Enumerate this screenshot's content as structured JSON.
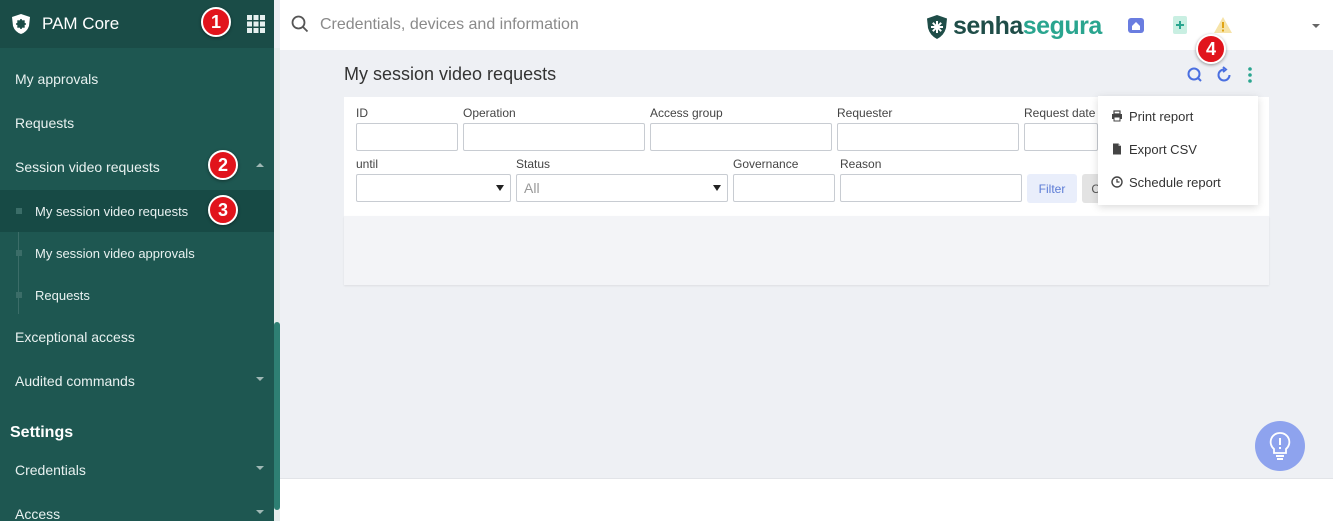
{
  "app": {
    "brand_name": "PAM Core",
    "logo_text_main": "senha",
    "logo_text_accent": "segura"
  },
  "search": {
    "placeholder": "Credentials, devices and information"
  },
  "sidebar": {
    "items": [
      {
        "label": "My approvals"
      },
      {
        "label": "Requests"
      },
      {
        "label": "Session video requests"
      },
      {
        "label": "Exceptional access"
      },
      {
        "label": "Audited commands"
      }
    ],
    "subitems": [
      {
        "label": "My session video requests"
      },
      {
        "label": "My session video approvals"
      },
      {
        "label": "Requests"
      }
    ],
    "settings_heading": "Settings",
    "settings_items": [
      {
        "label": "Credentials"
      },
      {
        "label": "Access"
      }
    ]
  },
  "page": {
    "title": "My session video requests"
  },
  "filters": {
    "id_label": "ID",
    "operation_label": "Operation",
    "access_group_label": "Access group",
    "requester_label": "Requester",
    "request_date_label": "Request date",
    "until_label": "until",
    "status_label": "Status",
    "status_value": "All",
    "governance_label": "Governance",
    "reason_label": "Reason",
    "filter_button": "Filter",
    "clear_button": "C"
  },
  "dropdown": {
    "items": [
      {
        "label": "Print report",
        "icon": "printer-icon"
      },
      {
        "label": "Export CSV",
        "icon": "file-icon"
      },
      {
        "label": "Schedule report",
        "icon": "clock-icon"
      }
    ]
  },
  "callouts": [
    "1",
    "2",
    "3",
    "4"
  ],
  "colors": {
    "sidebar": "#1e5751",
    "sidebar_header": "#1a4c47",
    "accent": "#2aa58f",
    "callout": "#e1141c",
    "help_button": "#8ea3ee"
  }
}
